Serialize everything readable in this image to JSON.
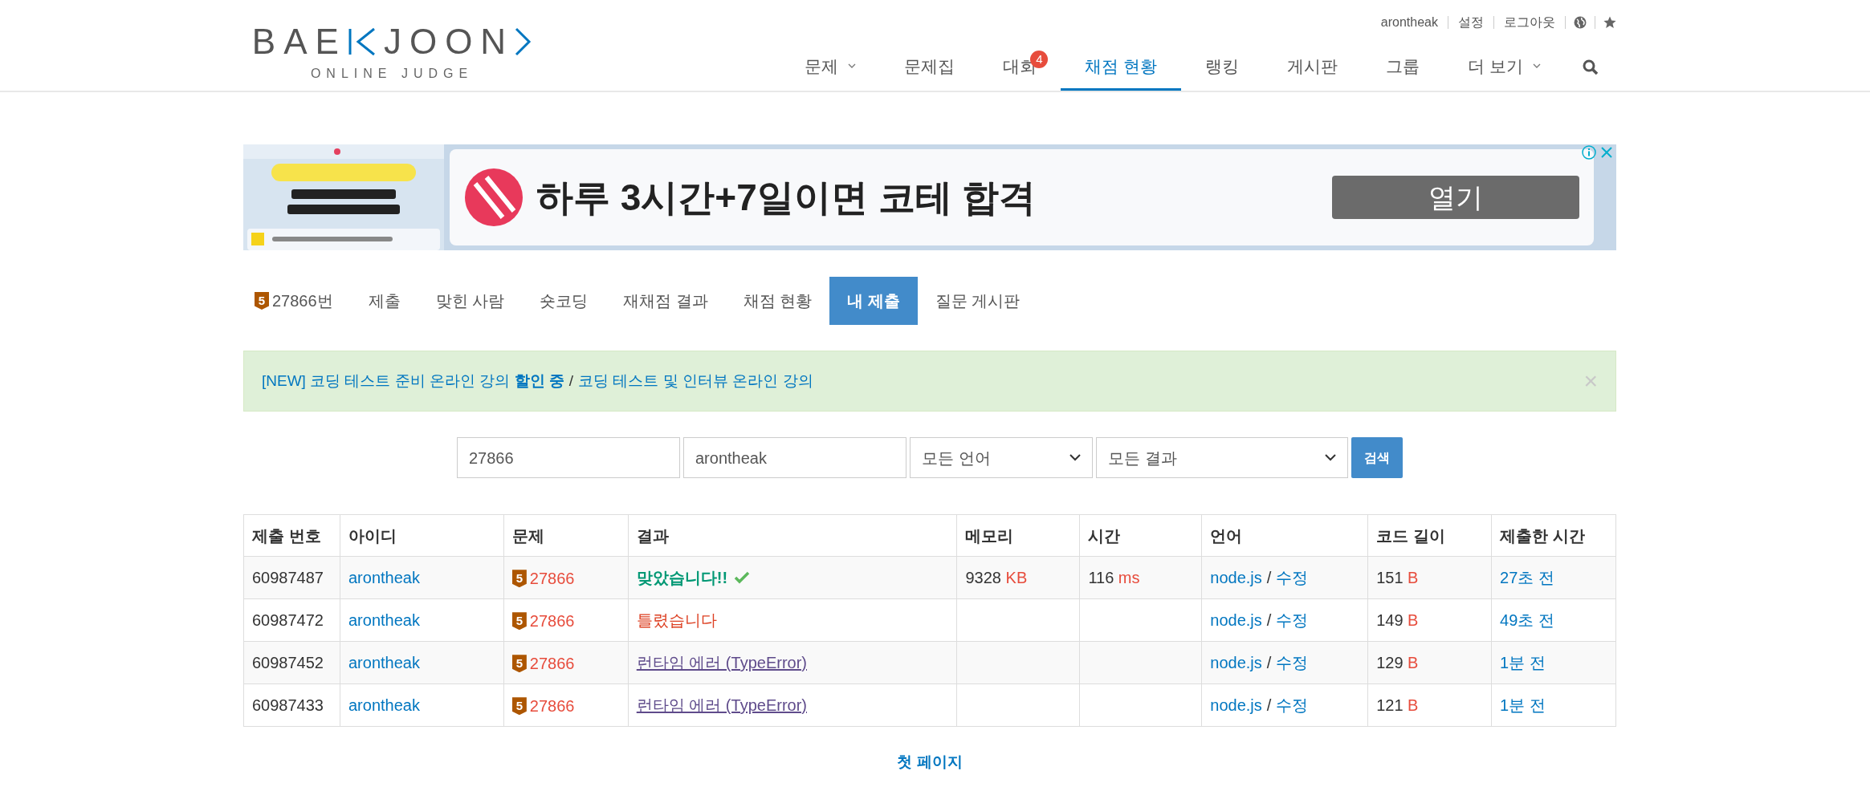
{
  "header": {
    "logo_left": "BAE",
    "logo_right": "JOON",
    "logo_subtitle": "ONLINE JUDGE",
    "top_links": [
      "arontheak",
      "설정",
      "로그아웃"
    ],
    "nav": [
      {
        "label": "문제",
        "dropdown": true,
        "selected": false
      },
      {
        "label": "문제집",
        "dropdown": false,
        "selected": false
      },
      {
        "label": "대회",
        "dropdown": false,
        "badge": "4",
        "selected": false
      },
      {
        "label": "채점 현황",
        "dropdown": false,
        "selected": true
      },
      {
        "label": "랭킹",
        "dropdown": false,
        "selected": false
      },
      {
        "label": "게시판",
        "dropdown": false,
        "selected": false
      },
      {
        "label": "그룹",
        "dropdown": false,
        "selected": false
      },
      {
        "label": "더 보기",
        "dropdown": true,
        "selected": false
      }
    ]
  },
  "ad": {
    "headline": "하루 3시간+7일이면 코테 합격",
    "button": "열기"
  },
  "problem_tabs": [
    {
      "label": "27866번",
      "tier": "5",
      "selected": false
    },
    {
      "label": "제출",
      "selected": false
    },
    {
      "label": "맞힌 사람",
      "selected": false
    },
    {
      "label": "숏코딩",
      "selected": false
    },
    {
      "label": "재채점 결과",
      "selected": false
    },
    {
      "label": "채점 현황",
      "selected": false
    },
    {
      "label": "내 제출",
      "selected": true
    },
    {
      "label": "질문 게시판",
      "selected": false
    }
  ],
  "alert": {
    "first_link": "[NEW] 코딩 테스트 준비 온라인 강의 **할인 중**",
    "separator": "/",
    "second_link": "코딩 테스트 및 인터뷰 온라인 강의",
    "close": "×"
  },
  "search": {
    "problem": "27866",
    "user": "arontheak",
    "language": "모든 언어",
    "result": "모든 결과",
    "button": "검색"
  },
  "table": {
    "columns": [
      "제출 번호",
      "아이디",
      "문제",
      "결과",
      "메모리",
      "시간",
      "언어",
      "코드 길이",
      "제출한 시간"
    ],
    "rows": [
      {
        "id": "60987487",
        "user": "arontheak",
        "tier": "5",
        "problem": "27866",
        "result": "맞았습니다!!",
        "kind": "accepted",
        "memory": "9328",
        "memory_unit": "KB",
        "time": "116",
        "time_unit": "ms",
        "language": "node.js",
        "separator": "/",
        "edit": "수정",
        "length": "151",
        "length_unit": "B",
        "submitted": "27초 전"
      },
      {
        "id": "60987472",
        "user": "arontheak",
        "tier": "5",
        "problem": "27866",
        "result": "틀렸습니다",
        "kind": "wrong",
        "language": "node.js",
        "separator": "/",
        "edit": "수정",
        "length": "149",
        "length_unit": "B",
        "submitted": "49초 전"
      },
      {
        "id": "60987452",
        "user": "arontheak",
        "tier": "5",
        "problem": "27866",
        "result": "런타임 에러 (TypeError)",
        "kind": "runtime_error",
        "language": "node.js",
        "separator": "/",
        "edit": "수정",
        "length": "129",
        "length_unit": "B",
        "submitted": "1분 전"
      },
      {
        "id": "60987433",
        "user": "arontheak",
        "tier": "5",
        "problem": "27866",
        "result": "런타임 에러 (TypeError)",
        "kind": "runtime_error",
        "language": "node.js",
        "separator": "/",
        "edit": "수정",
        "length": "121",
        "length_unit": "B",
        "submitted": "1분 전"
      }
    ]
  },
  "pager": {
    "first_page": "첫 페이지"
  }
}
